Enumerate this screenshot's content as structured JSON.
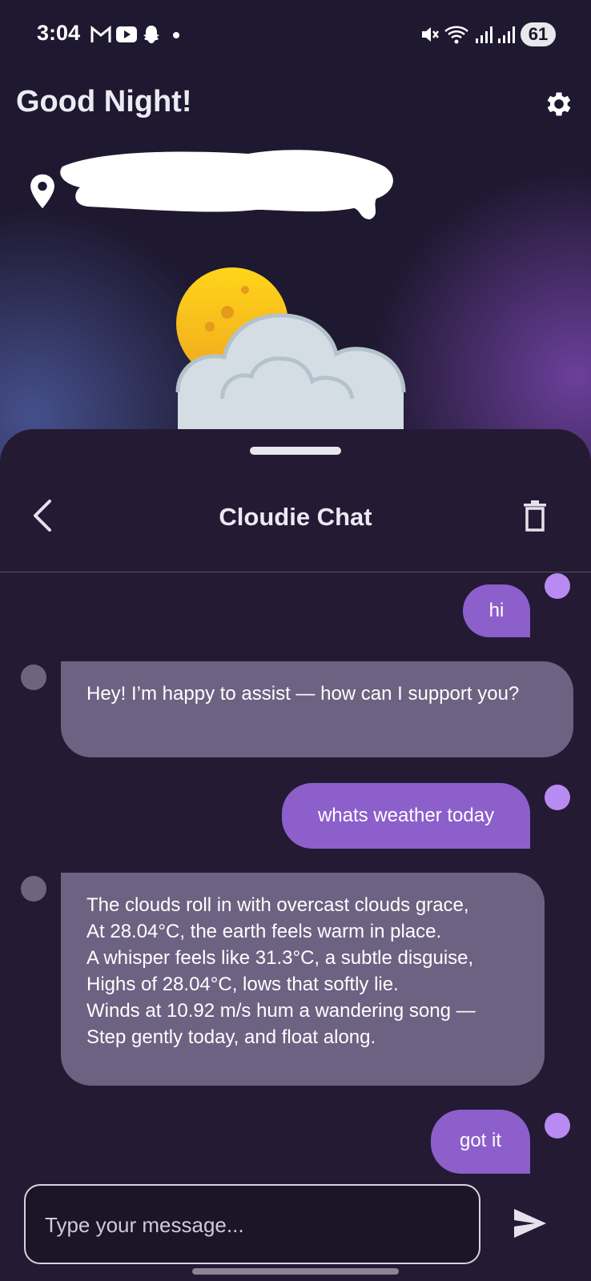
{
  "status_bar": {
    "time": "3:04",
    "battery": "61",
    "icons": [
      "gmail-icon",
      "youtube-icon",
      "snapchat-icon",
      "notification-dot-icon",
      "mute-icon",
      "wifi-icon",
      "signal-icon",
      "signal-icon"
    ]
  },
  "header": {
    "greeting": "Good Night!",
    "settings_icon": "gear-icon",
    "location_icon": "location-pin-icon",
    "weather_icon": "moon-cloud-icon"
  },
  "chat": {
    "title": "Cloudie Chat",
    "back_icon": "chevron-left-icon",
    "clear_icon": "trash-icon",
    "messages": [
      {
        "role": "user",
        "text": "hi"
      },
      {
        "role": "bot",
        "text": "Hey! I’m happy to assist — how can I support you?"
      },
      {
        "role": "user",
        "text": "whats weather today"
      },
      {
        "role": "bot",
        "lines": [
          "The clouds roll in with overcast clouds grace,",
          "At 28.04°C, the earth feels warm in place.",
          "A whisper feels like 31.3°C, a subtle disguise,",
          "Highs of 28.04°C, lows that softly lie.",
          "Winds at 10.92 m/s hum a wandering song —",
          "Step gently today, and float along."
        ]
      },
      {
        "role": "user",
        "text": "got it"
      }
    ],
    "input": {
      "placeholder": "Type your message...",
      "value": ""
    },
    "send_icon": "send-icon"
  },
  "colors": {
    "background": "#1c1528",
    "sheet": "#241a34",
    "user_bubble": "#8c5fcb",
    "bot_bubble": "#6d6282",
    "user_dot": "#b88bf2"
  }
}
